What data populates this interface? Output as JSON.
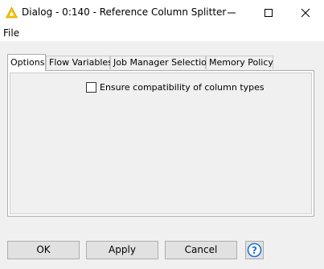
{
  "window": {
    "title": "Dialog - 0:140 - Reference Column Splitter",
    "icon": "knime-warning-triangle-icon",
    "controls": [
      "minimize-icon",
      "maximize-icon",
      "close-icon"
    ]
  },
  "menu": {
    "file": "File"
  },
  "tabs": [
    {
      "label": "Options",
      "active": true
    },
    {
      "label": "Flow Variables",
      "active": false
    },
    {
      "label": "Job Manager Selection",
      "active": false
    },
    {
      "label": "Memory Policy",
      "active": false
    }
  ],
  "options": {
    "ensure_compat_label": "Ensure compatibility of column types",
    "ensure_compat_checked": false
  },
  "buttons": {
    "ok": "OK",
    "apply": "Apply",
    "cancel": "Cancel",
    "help_icon": "help-question-icon"
  },
  "colors": {
    "accent_yellow": "#f2c200",
    "help_blue": "#1e73c9"
  }
}
